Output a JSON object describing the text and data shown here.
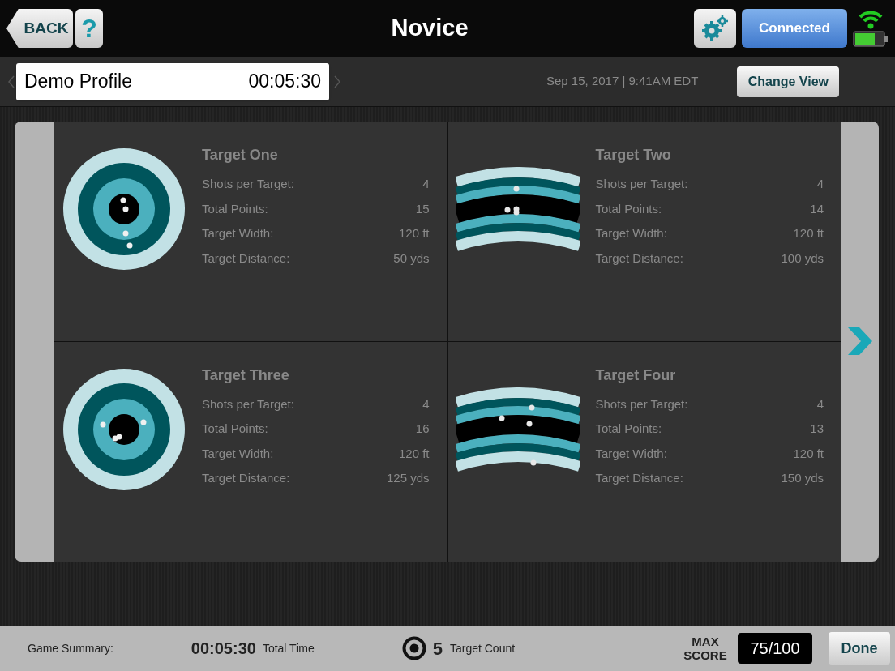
{
  "header": {
    "back_button": "BACK",
    "help_button": "?",
    "title": "Novice",
    "connect_button": "Connected"
  },
  "profile_bar": {
    "profile": "Demo Profile",
    "time": "00:05:30",
    "datetime": "Sep 15, 2017 | 9:41AM EDT",
    "view_button": "Change View"
  },
  "targets": [
    {
      "kind": "round",
      "name": "Target One",
      "stats": [
        {
          "label": "Shots per Target:",
          "value": "4"
        },
        {
          "label": "Total Points:",
          "value": "15"
        },
        {
          "label": "Target Width:",
          "value": "120 ft"
        },
        {
          "label": "Target Distance:",
          "value": "50 yds"
        }
      ]
    },
    {
      "kind": "arc",
      "name": "Target Two",
      "stats": [
        {
          "label": "Shots per Target:",
          "value": "4"
        },
        {
          "label": "Total Points:",
          "value": "14"
        },
        {
          "label": "Target Width:",
          "value": "120 ft"
        },
        {
          "label": "Target Distance:",
          "value": "100 yds"
        }
      ]
    },
    {
      "kind": "round",
      "name": "Target Three",
      "stats": [
        {
          "label": "Shots per Target:",
          "value": "4"
        },
        {
          "label": "Total Points:",
          "value": "16"
        },
        {
          "label": "Target Width:",
          "value": "120 ft"
        },
        {
          "label": "Target Distance:",
          "value": "125 yds"
        }
      ]
    },
    {
      "kind": "arc",
      "name": "Target Four",
      "stats": [
        {
          "label": "Shots per Target:",
          "value": "4"
        },
        {
          "label": "Total Points:",
          "value": "13"
        },
        {
          "label": "Target Width:",
          "value": "120 ft"
        },
        {
          "label": "Target Distance:",
          "value": "150 yds"
        }
      ]
    }
  ],
  "summary": {
    "label": "Game Summary:",
    "total_time": "00:05:30",
    "total_time_label": "Total Time",
    "target_count": "5",
    "target_count_label": "Target Count",
    "max_score_label": "MAX SCORE",
    "max_score": "75/100",
    "done_button": "Done"
  }
}
